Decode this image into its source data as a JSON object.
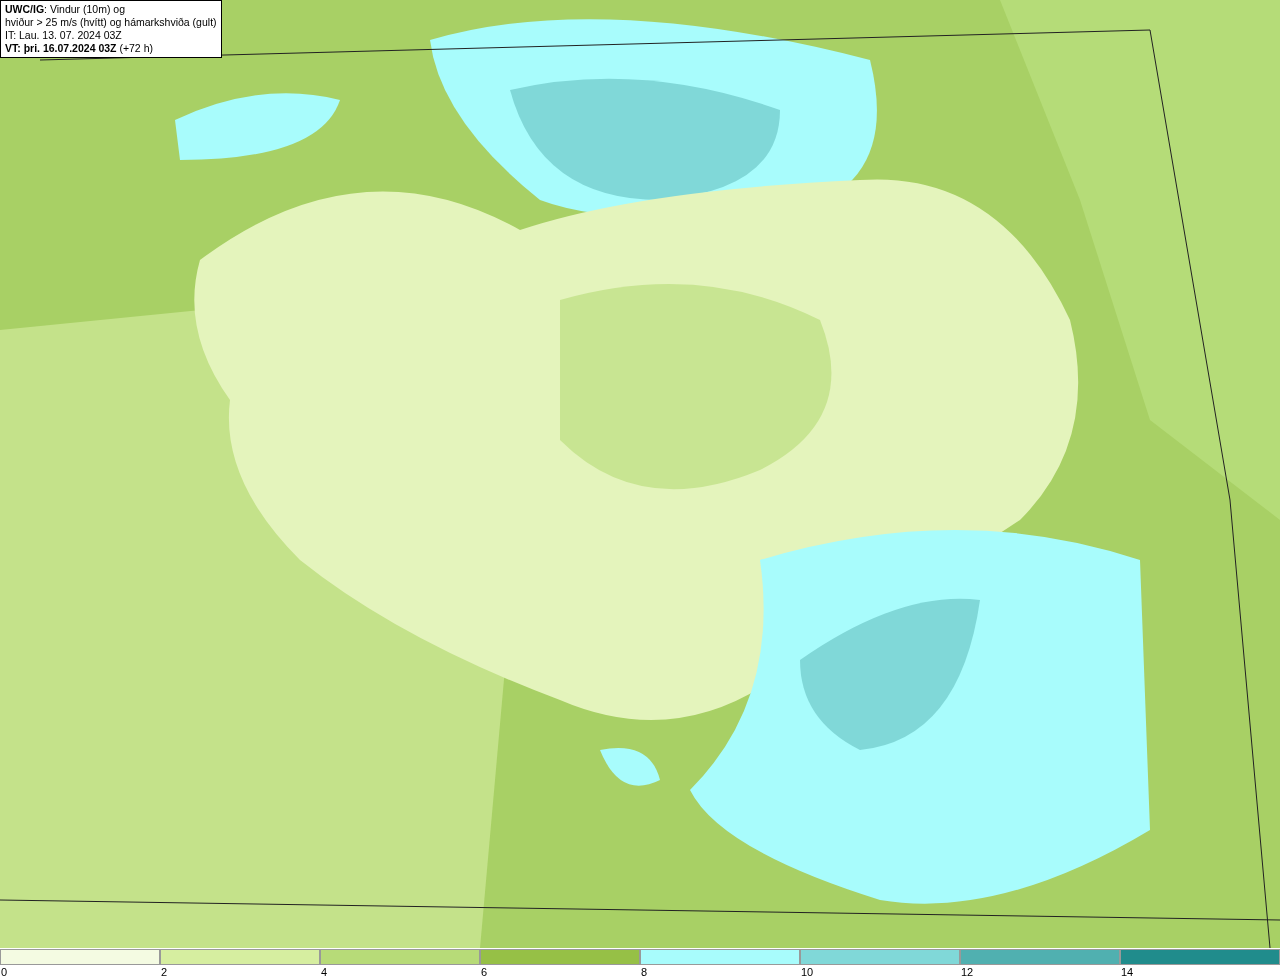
{
  "title_box": {
    "lines": [
      "**UWC/IG**: Vindur (10m) og",
      "hviður > 25 m/s (hvítt) og hámarkshviða (gult)",
      "IT: Lau. 13. 07. 2024 03Z",
      "**VT: þri. 16.07.2024 03Z** (+72 h)"
    ]
  },
  "legend": {
    "bins": [
      {
        "label": "0",
        "color": "#f4fbe2"
      },
      {
        "label": "2",
        "color": "#d6eea0"
      },
      {
        "label": "4",
        "color": "#b7db78"
      },
      {
        "label": "6",
        "color": "#96c046"
      },
      {
        "label": "8",
        "color": "#a8fcfc"
      },
      {
        "label": "10",
        "color": "#80d8d8"
      },
      {
        "label": "12",
        "color": "#50b0b0"
      },
      {
        "label": "14",
        "color": "#208c8c"
      }
    ]
  }
}
